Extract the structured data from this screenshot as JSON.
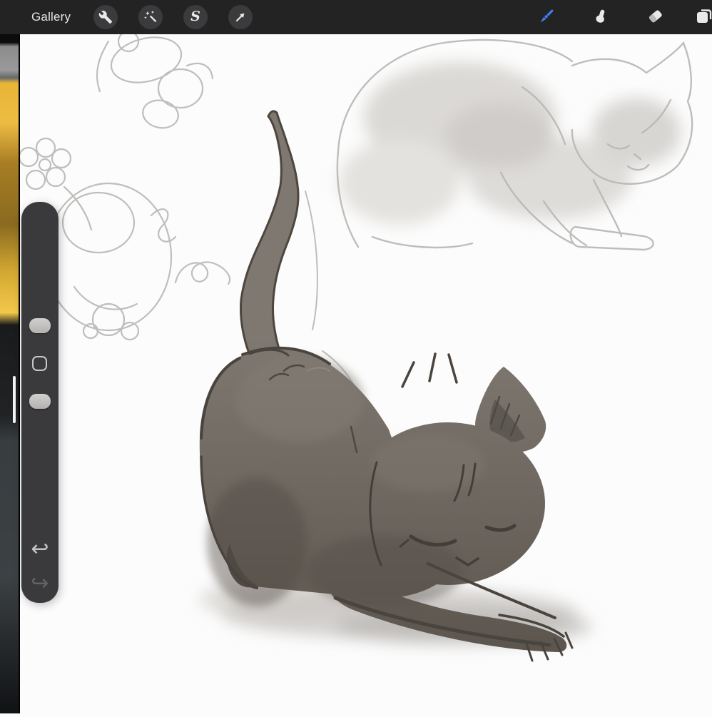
{
  "top_bar": {
    "gallery_label": "Gallery",
    "left_tools": [
      {
        "id": "actions",
        "icon": "wrench-icon"
      },
      {
        "id": "adjustments",
        "icon": "magic-wand-icon"
      },
      {
        "id": "selection",
        "icon": "selection-s-icon",
        "glyph": "S"
      },
      {
        "id": "transform",
        "icon": "transform-arrow-icon"
      }
    ],
    "right_tools": [
      {
        "id": "paint",
        "icon": "paintbrush-icon",
        "active": true
      },
      {
        "id": "smudge",
        "icon": "smudge-finger-icon",
        "active": false
      },
      {
        "id": "erase",
        "icon": "eraser-icon",
        "active": false
      },
      {
        "id": "layers",
        "icon": "layers-icon",
        "active": false
      }
    ],
    "colors": {
      "bar_bg": "#232323",
      "button_bg": "#3b3b3d",
      "icon": "#e9e9e9",
      "active_accent": "#3c82f7"
    }
  },
  "sidebar": {
    "undo_glyph": "↩",
    "redo_glyph": "↪",
    "panel_bg": "#3a3a3c"
  },
  "canvas": {
    "background": "#fcfcfc",
    "cat_fill": "#6d6760",
    "description": "Dark grey cat stretching with arched back and raised tail; faint pencil doodles top-left and a faint sketched cat top-right"
  }
}
